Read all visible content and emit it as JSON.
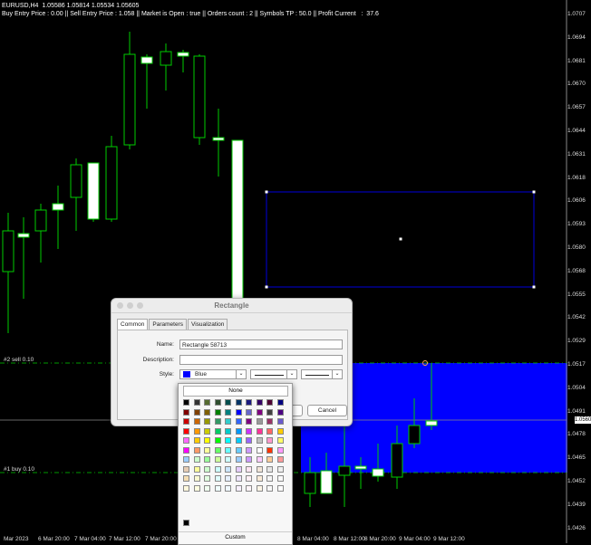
{
  "header": {
    "symbol_line": "EURUSD,H4  1.05586 1.05814 1.05534 1.05605",
    "status_line": "Buy Entry Price : 0.00 || Sell Entry Price : 1.058 || Market is Open : true || Orders count : 2 || Symbols TP : 50.0 || Profit Current   :  37.6"
  },
  "price_axis": [
    "1.0707",
    "1.0694",
    "1.0681",
    "1.0670",
    "1.0657",
    "1.0644",
    "1.0631",
    "1.0618",
    "1.0606",
    "1.0593",
    "1.0580",
    "1.0568",
    "1.0555",
    "1.0542",
    "1.0529",
    "1.0517",
    "1.0504",
    "1.0491",
    "1.0478",
    "1.0465",
    "1.0452",
    "1.0439",
    "1.0426"
  ],
  "bid_label": "1.0560",
  "time_axis": [
    "Mar 2023",
    "6 Mar 20:00",
    "7 Mar 04:00",
    "7 Mar 12:00",
    "7 Mar 20:00",
    "8 Mar 04:00",
    "8 Mar 12:00",
    "8 Mar 20:00",
    "9 Mar 04:00",
    "9 Mar 12:00"
  ],
  "levels": {
    "sell": "#2 sell 0.10",
    "buy": "#1 buy 0.10"
  },
  "colors": {
    "bull": "#00cc00",
    "bear_fill": "#ffffff",
    "rect_border": "#0000dd",
    "zone": "#0000ff",
    "level_line": "#00cc00"
  },
  "dialog": {
    "title": "Rectangle",
    "tabs": [
      "Common",
      "Parameters",
      "Visualization"
    ],
    "name_label": "Name:",
    "name_value": "Rectangle 58713",
    "description_label": "Description:",
    "description_value": "",
    "style_label": "Style:",
    "color_value": "Blue",
    "ok_label": "",
    "cancel_label": "Cancel"
  },
  "palette": {
    "none_label": "None",
    "custom_label": "Custom",
    "rows": [
      [
        "#000000",
        "#333333",
        "#556b2f",
        "#2e4e2e",
        "#004d4d",
        "#003366",
        "#1a1a80",
        "#330066",
        "#4d0033",
        "#000080"
      ],
      [
        "#800000",
        "#804000",
        "#806000",
        "#008000",
        "#008080",
        "#0000ff",
        "#6666cc",
        "#800080",
        "#404040",
        "#4b0082"
      ],
      [
        "#cc0000",
        "#cc6600",
        "#999900",
        "#339966",
        "#33cccc",
        "#3366ff",
        "#800080",
        "#999999",
        "#993366",
        "#6a5acd"
      ],
      [
        "#ff0000",
        "#ff9900",
        "#cccc00",
        "#00cc66",
        "#00cccc",
        "#0099ff",
        "#cc33ff",
        "#ff3399",
        "#ff6666",
        "#ffcc00"
      ],
      [
        "#ff66ff",
        "#ffcc00",
        "#ffff00",
        "#00ff00",
        "#00ffff",
        "#00ccff",
        "#9966ff",
        "#c0c0c0",
        "#ff99cc",
        "#ffff66"
      ],
      [
        "#ff00ff",
        "#ff9966",
        "#ffff99",
        "#66ff66",
        "#66ffff",
        "#66ccff",
        "#cc99ff",
        "#ffffff",
        "#ff3300",
        "#ff99ff"
      ],
      [
        "#99ccff",
        "#ccffcc",
        "#99ff99",
        "#ccff99",
        "#ccffff",
        "#99ccff",
        "#cc99ff",
        "#ffccff",
        "#ffcc99",
        "#ff9999"
      ],
      [
        "#e6ccb3",
        "#ffff99",
        "#ccffcc",
        "#ccffff",
        "#cce6ff",
        "#e6ccff",
        "#ffe6f2",
        "#f2e6d9",
        "#e6e6e6",
        "#f0f0f0"
      ],
      [
        "#f5deb3",
        "#fafad2",
        "#e0ffe0",
        "#e0ffff",
        "#e6f0ff",
        "#f0e6ff",
        "#fff0f5",
        "#faebd7",
        "#f5f5f5",
        "#fafafa"
      ],
      [
        "#fff8dc",
        "#ffffe0",
        "#f0fff0",
        "#f0ffff",
        "#f0f8ff",
        "#f8f0ff",
        "#fff5f8",
        "#fdf5e6",
        "#f8f8f8",
        "#ffffff"
      ]
    ],
    "custom_swatches": [
      "#000000"
    ]
  }
}
